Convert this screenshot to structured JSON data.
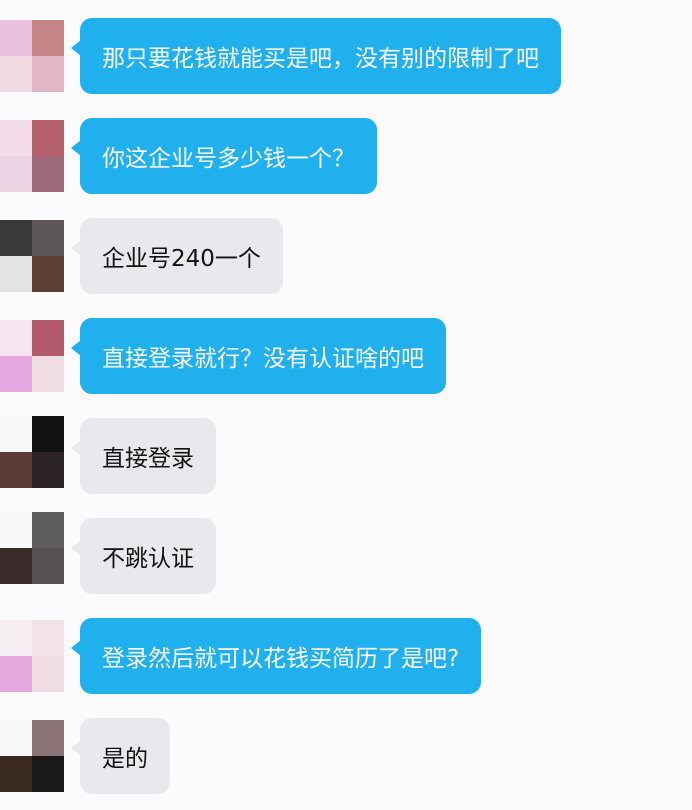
{
  "conversation": {
    "messages": [
      {
        "text": "那只要花钱就能买是吧，没有别的限制了吧",
        "style": "blue",
        "avatar_colors": [
          "#e9c0de",
          "#c58585",
          "#f0dbe3",
          "#e2b7c5"
        ]
      },
      {
        "text": "你这企业号多少钱一个？",
        "style": "blue",
        "avatar_colors": [
          "#f3dce8",
          "#b5606c",
          "#ead3e3",
          "#9c6a78"
        ]
      },
      {
        "text": "企业号240一个",
        "style": "grey",
        "avatar_colors": [
          "#3a3a3a",
          "#5d5757",
          "#e4e4e4",
          "#5d3e35"
        ]
      },
      {
        "text": "直接登录就行？没有认证啥的吧",
        "style": "blue",
        "avatar_colors": [
          "#f6e4ee",
          "#b45a6e",
          "#e6a6df",
          "#f0dde2"
        ]
      },
      {
        "text": "直接登录",
        "style": "grey",
        "avatar_colors": [
          "#f7f7f7",
          "#121212",
          "#5a3a37",
          "#2d2525"
        ]
      },
      {
        "text": "不跳认证",
        "style": "grey",
        "avatar_colors": [
          "#f8f8f8",
          "#5e5e5e",
          "#3a2a2a",
          "#565252"
        ]
      },
      {
        "text": "登录然后就可以花钱买简历了是吧?",
        "style": "blue",
        "avatar_colors": [
          "#f5eef3",
          "#f1e3e6",
          "#e6a8de",
          "#f1dee4"
        ]
      },
      {
        "text": "是的",
        "style": "grey",
        "avatar_colors": [
          "#f7f7f7",
          "#8a7276",
          "#3a2a22",
          "#191919"
        ]
      }
    ]
  }
}
